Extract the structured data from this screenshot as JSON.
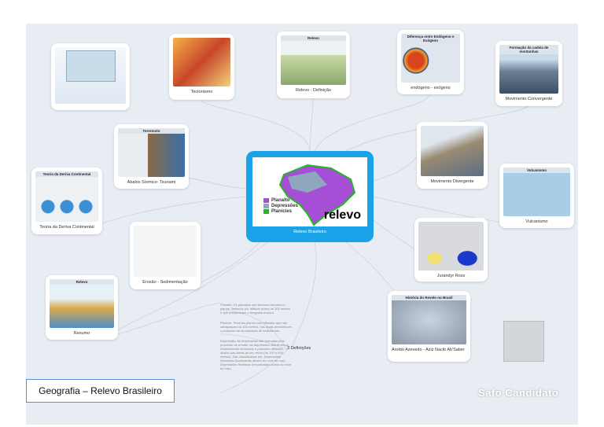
{
  "title": "Geografia – Relevo Brasileiro",
  "brand": "Safo Candidato",
  "logo_text": "SAFO CANDIDATO",
  "central": {
    "caption": "Relevo Brasileiro",
    "word": "relevo",
    "legend": [
      {
        "label": "Planalto",
        "color": "#a54fd6"
      },
      {
        "label": "Depressões",
        "color": "#8fa6bf"
      },
      {
        "label": "Planícies",
        "color": "#22b822"
      }
    ]
  },
  "nodes": {
    "tectonismo": {
      "caption": "Tectonismo"
    },
    "definicao": {
      "header": "Relevo",
      "caption": "Relevo - Definição"
    },
    "endogeno": {
      "header": "Diferença entre Endógeno e Exógeno",
      "caption": "endógeno - exógeno"
    },
    "convergente": {
      "header": "Formação da cadeia de montanhas",
      "caption": "Movimento Convergente"
    },
    "terremoto": {
      "header": "Terremoto",
      "caption": "Abalos Sísmico- Tsunami"
    },
    "deriva": {
      "header": "Teoria da Deriva Continental",
      "caption": "Teoria da Deriva Continental"
    },
    "divergente": {
      "caption": "Movimento Divergente"
    },
    "vulcanismo": {
      "header": "Vulcanismo",
      "caption": "Vulcanismo"
    },
    "ross": {
      "caption": "Jurandyr Ross"
    },
    "erosao": {
      "caption": "Erosão - Sedimentação"
    },
    "resumo": {
      "header": "Relevo",
      "caption": "Resumo"
    },
    "aroldo": {
      "header": "História do Revelo no Brasil",
      "caption": "Aroldo Azevedo - Aziz Nacib Ab'Saber"
    }
  },
  "definitions": {
    "label": "3 Definições",
    "items": [
      "Planalto: Os planaltos são terrenos elevados e planos, limitados por altitude acima de 300 metros e que predominam o desgaste erosivo.",
      "Planície: Terrenos planos com altitudes que não ultrapassam os 100 metros, nos quais predominam o processo de acumulação de sedimentos.",
      "Depressão: As depressões são formadas pelo processo de erosão, as depressões são terrenos relativamente inclinados e possuem altitudes abaixo das áreas ao seu redor (de 100 a 500 metros). São classificadas em: Depressões Absolutas (localizadas abaixo do nível do mar) Depressões Relativas (encontradas acima do nível do mar)"
    ]
  }
}
